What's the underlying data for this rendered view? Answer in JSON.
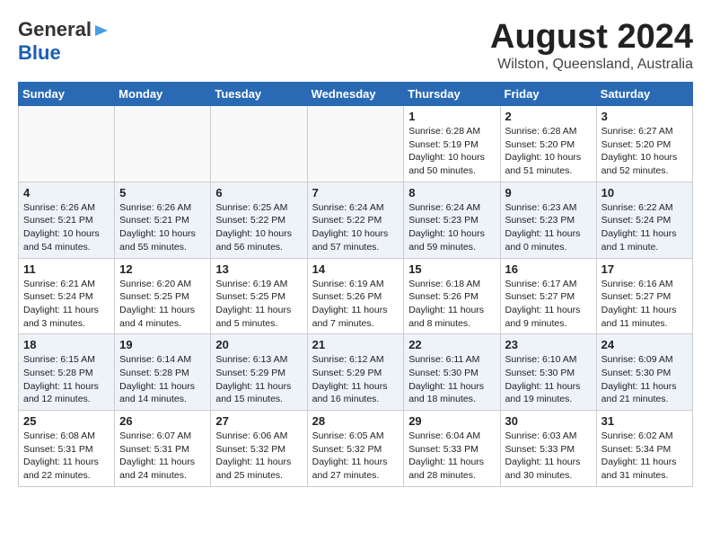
{
  "logo": {
    "line1": "General",
    "line2": "Blue"
  },
  "title": "August 2024",
  "subtitle": "Wilston, Queensland, Australia",
  "weekdays": [
    "Sunday",
    "Monday",
    "Tuesday",
    "Wednesday",
    "Thursday",
    "Friday",
    "Saturday"
  ],
  "weeks": [
    [
      {
        "day": "",
        "sunrise": "",
        "sunset": "",
        "daylight": ""
      },
      {
        "day": "",
        "sunrise": "",
        "sunset": "",
        "daylight": ""
      },
      {
        "day": "",
        "sunrise": "",
        "sunset": "",
        "daylight": ""
      },
      {
        "day": "",
        "sunrise": "",
        "sunset": "",
        "daylight": ""
      },
      {
        "day": "1",
        "sunrise": "Sunrise: 6:28 AM",
        "sunset": "Sunset: 5:19 PM",
        "daylight": "Daylight: 10 hours and 50 minutes."
      },
      {
        "day": "2",
        "sunrise": "Sunrise: 6:28 AM",
        "sunset": "Sunset: 5:20 PM",
        "daylight": "Daylight: 10 hours and 51 minutes."
      },
      {
        "day": "3",
        "sunrise": "Sunrise: 6:27 AM",
        "sunset": "Sunset: 5:20 PM",
        "daylight": "Daylight: 10 hours and 52 minutes."
      }
    ],
    [
      {
        "day": "4",
        "sunrise": "Sunrise: 6:26 AM",
        "sunset": "Sunset: 5:21 PM",
        "daylight": "Daylight: 10 hours and 54 minutes."
      },
      {
        "day": "5",
        "sunrise": "Sunrise: 6:26 AM",
        "sunset": "Sunset: 5:21 PM",
        "daylight": "Daylight: 10 hours and 55 minutes."
      },
      {
        "day": "6",
        "sunrise": "Sunrise: 6:25 AM",
        "sunset": "Sunset: 5:22 PM",
        "daylight": "Daylight: 10 hours and 56 minutes."
      },
      {
        "day": "7",
        "sunrise": "Sunrise: 6:24 AM",
        "sunset": "Sunset: 5:22 PM",
        "daylight": "Daylight: 10 hours and 57 minutes."
      },
      {
        "day": "8",
        "sunrise": "Sunrise: 6:24 AM",
        "sunset": "Sunset: 5:23 PM",
        "daylight": "Daylight: 10 hours and 59 minutes."
      },
      {
        "day": "9",
        "sunrise": "Sunrise: 6:23 AM",
        "sunset": "Sunset: 5:23 PM",
        "daylight": "Daylight: 11 hours and 0 minutes."
      },
      {
        "day": "10",
        "sunrise": "Sunrise: 6:22 AM",
        "sunset": "Sunset: 5:24 PM",
        "daylight": "Daylight: 11 hours and 1 minute."
      }
    ],
    [
      {
        "day": "11",
        "sunrise": "Sunrise: 6:21 AM",
        "sunset": "Sunset: 5:24 PM",
        "daylight": "Daylight: 11 hours and 3 minutes."
      },
      {
        "day": "12",
        "sunrise": "Sunrise: 6:20 AM",
        "sunset": "Sunset: 5:25 PM",
        "daylight": "Daylight: 11 hours and 4 minutes."
      },
      {
        "day": "13",
        "sunrise": "Sunrise: 6:19 AM",
        "sunset": "Sunset: 5:25 PM",
        "daylight": "Daylight: 11 hours and 5 minutes."
      },
      {
        "day": "14",
        "sunrise": "Sunrise: 6:19 AM",
        "sunset": "Sunset: 5:26 PM",
        "daylight": "Daylight: 11 hours and 7 minutes."
      },
      {
        "day": "15",
        "sunrise": "Sunrise: 6:18 AM",
        "sunset": "Sunset: 5:26 PM",
        "daylight": "Daylight: 11 hours and 8 minutes."
      },
      {
        "day": "16",
        "sunrise": "Sunrise: 6:17 AM",
        "sunset": "Sunset: 5:27 PM",
        "daylight": "Daylight: 11 hours and 9 minutes."
      },
      {
        "day": "17",
        "sunrise": "Sunrise: 6:16 AM",
        "sunset": "Sunset: 5:27 PM",
        "daylight": "Daylight: 11 hours and 11 minutes."
      }
    ],
    [
      {
        "day": "18",
        "sunrise": "Sunrise: 6:15 AM",
        "sunset": "Sunset: 5:28 PM",
        "daylight": "Daylight: 11 hours and 12 minutes."
      },
      {
        "day": "19",
        "sunrise": "Sunrise: 6:14 AM",
        "sunset": "Sunset: 5:28 PM",
        "daylight": "Daylight: 11 hours and 14 minutes."
      },
      {
        "day": "20",
        "sunrise": "Sunrise: 6:13 AM",
        "sunset": "Sunset: 5:29 PM",
        "daylight": "Daylight: 11 hours and 15 minutes."
      },
      {
        "day": "21",
        "sunrise": "Sunrise: 6:12 AM",
        "sunset": "Sunset: 5:29 PM",
        "daylight": "Daylight: 11 hours and 16 minutes."
      },
      {
        "day": "22",
        "sunrise": "Sunrise: 6:11 AM",
        "sunset": "Sunset: 5:30 PM",
        "daylight": "Daylight: 11 hours and 18 minutes."
      },
      {
        "day": "23",
        "sunrise": "Sunrise: 6:10 AM",
        "sunset": "Sunset: 5:30 PM",
        "daylight": "Daylight: 11 hours and 19 minutes."
      },
      {
        "day": "24",
        "sunrise": "Sunrise: 6:09 AM",
        "sunset": "Sunset: 5:30 PM",
        "daylight": "Daylight: 11 hours and 21 minutes."
      }
    ],
    [
      {
        "day": "25",
        "sunrise": "Sunrise: 6:08 AM",
        "sunset": "Sunset: 5:31 PM",
        "daylight": "Daylight: 11 hours and 22 minutes."
      },
      {
        "day": "26",
        "sunrise": "Sunrise: 6:07 AM",
        "sunset": "Sunset: 5:31 PM",
        "daylight": "Daylight: 11 hours and 24 minutes."
      },
      {
        "day": "27",
        "sunrise": "Sunrise: 6:06 AM",
        "sunset": "Sunset: 5:32 PM",
        "daylight": "Daylight: 11 hours and 25 minutes."
      },
      {
        "day": "28",
        "sunrise": "Sunrise: 6:05 AM",
        "sunset": "Sunset: 5:32 PM",
        "daylight": "Daylight: 11 hours and 27 minutes."
      },
      {
        "day": "29",
        "sunrise": "Sunrise: 6:04 AM",
        "sunset": "Sunset: 5:33 PM",
        "daylight": "Daylight: 11 hours and 28 minutes."
      },
      {
        "day": "30",
        "sunrise": "Sunrise: 6:03 AM",
        "sunset": "Sunset: 5:33 PM",
        "daylight": "Daylight: 11 hours and 30 minutes."
      },
      {
        "day": "31",
        "sunrise": "Sunrise: 6:02 AM",
        "sunset": "Sunset: 5:34 PM",
        "daylight": "Daylight: 11 hours and 31 minutes."
      }
    ]
  ]
}
